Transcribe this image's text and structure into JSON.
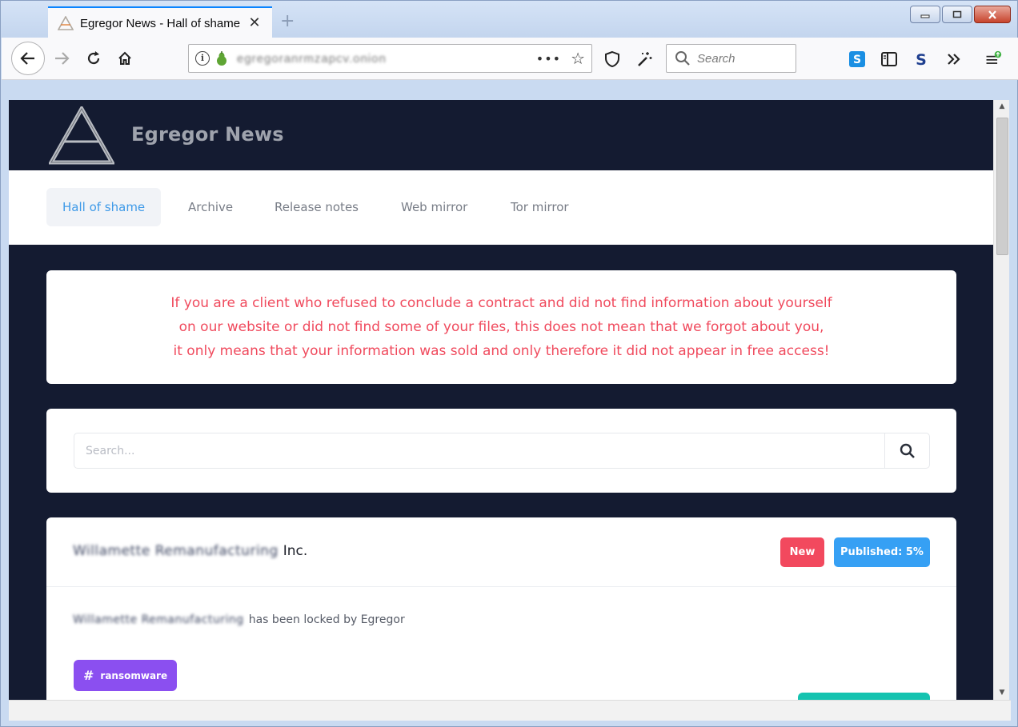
{
  "browser": {
    "tab_title": "Egregor News - Hall of shame",
    "tab_close": "✕",
    "new_tab": "+",
    "url": "egregoranrmzapcv.onion",
    "url_more": "•••",
    "search_placeholder": "Search",
    "window_controls": {
      "minimize": "▭",
      "restore": "▢",
      "close": "✕"
    }
  },
  "site": {
    "brand": "Egregor News",
    "nav": [
      {
        "label": "Hall of shame",
        "active": true
      },
      {
        "label": "Archive"
      },
      {
        "label": "Release notes"
      },
      {
        "label": "Web mirror"
      },
      {
        "label": "Tor mirror"
      }
    ],
    "notice": {
      "line1": "If you are a client who refused to conclude a contract and did not find information about yourself",
      "line2": "on our website or did not find some of your files, this does not mean that we forgot about you,",
      "line3": "it only means that your information was sold and only therefore it did not appear in free access!"
    },
    "search": {
      "placeholder": "Search..."
    },
    "entry": {
      "company_redacted": "Willamette Remanufacturing",
      "company_suffix": "Inc.",
      "badge_new": "New",
      "badge_published": "Published: 5%",
      "locked_redacted": "Willamette Remanufacturing",
      "locked_text": "has been locked by Egregor",
      "tag_hash": "#",
      "tag_label": "ransomware"
    }
  },
  "colors": {
    "page_bg": "#141b31",
    "notice_text": "#f04a5d",
    "nav_active": "#3f9ae8",
    "badge_new": "#f2495e",
    "badge_published": "#36a0f4",
    "tag": "#8b4ff0",
    "teal_button": "#15c3b0"
  }
}
